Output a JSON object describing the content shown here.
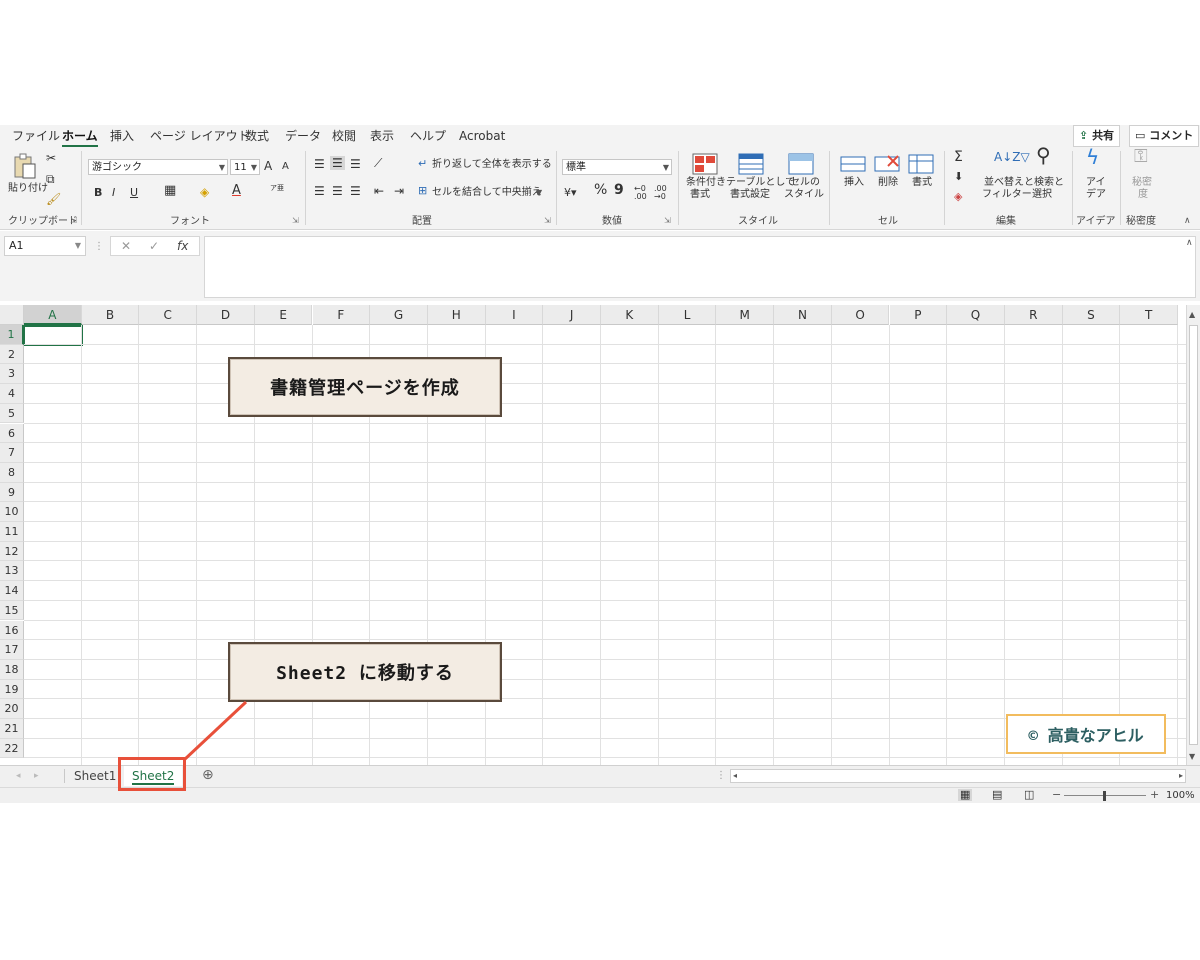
{
  "ribbon_tabs": [
    "ファイル",
    "ホーム",
    "挿入",
    "ページ レイアウト",
    "数式",
    "データ",
    "校閲",
    "表示",
    "ヘルプ",
    "Acrobat"
  ],
  "share_label": "共有",
  "comment_label": "コメント",
  "ribbon": {
    "clipboard": {
      "paste": "貼り付け",
      "group": "クリップボード"
    },
    "font": {
      "name": "游ゴシック",
      "size": "11",
      "group": "フォント",
      "bold": "B",
      "italic": "I",
      "underline": "U",
      "grow": "A",
      "shrink": "A",
      "furigana": "ア亜",
      "color_a": "A"
    },
    "alignment": {
      "wrap": "折り返して全体を表示する",
      "merge": "セルを結合して中央揃え",
      "group": "配置"
    },
    "number": {
      "format": "標準",
      "percent": "%",
      "comma": "9",
      "group": "数値"
    },
    "styles": {
      "conditional": "条件付き",
      "conditional2": "書式",
      "table": "テーブルとして",
      "table2": "書式設定",
      "cell": "セルの",
      "cell2": "スタイル",
      "group": "スタイル"
    },
    "cells": {
      "insert": "挿入",
      "delete": "削除",
      "format": "書式",
      "group": "セル"
    },
    "editing": {
      "sum": "Σ",
      "sort": "並べ替えと",
      "sort2": "フィルター",
      "find": "検索と",
      "find2": "選択",
      "group": "編集"
    },
    "ideas": {
      "label": "アイ",
      "label2": "デア",
      "group": "アイデア"
    },
    "sensitivity": {
      "label": "秘密",
      "label2": "度",
      "group": "秘密度"
    }
  },
  "formula_bar": {
    "name_box": "A1",
    "cancel": "✕",
    "enter": "✓",
    "fx": "fx",
    "value": ""
  },
  "columns": [
    "A",
    "B",
    "C",
    "D",
    "E",
    "F",
    "G",
    "H",
    "I",
    "J",
    "K",
    "L",
    "M",
    "N",
    "O",
    "P",
    "Q",
    "R",
    "S",
    "T"
  ],
  "rows": [
    "1",
    "2",
    "3",
    "4",
    "5",
    "6",
    "7",
    "8",
    "9",
    "10",
    "11",
    "12",
    "13",
    "14",
    "15",
    "16",
    "17",
    "18",
    "19",
    "20",
    "21",
    "22"
  ],
  "selected_cell": "A1",
  "sheets": [
    "Sheet1",
    "Sheet2"
  ],
  "active_sheet": "Sheet2",
  "zoom": "100%",
  "callouts": {
    "top": "書籍管理ページを作成",
    "bottom": "Sheet2 に移動する"
  },
  "copyright": "© 高貴なアヒル",
  "colors": {
    "accent": "#217346",
    "highlight": "#e8503a",
    "callout_bg": "#f3ece3",
    "callout_border": "#5a4a3c",
    "copyright_border": "#f2bc5e"
  }
}
